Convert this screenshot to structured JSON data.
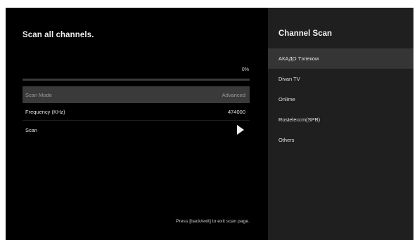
{
  "main": {
    "title": "Scan all channels.",
    "progress": {
      "label": "0%",
      "percent": 0
    },
    "rows": [
      {
        "label": "Scan Mode",
        "value": "Advanced"
      },
      {
        "label": "Frequency (KHz)",
        "value": "474000"
      },
      {
        "label": "Scan",
        "icon": "play-icon"
      }
    ],
    "footer_hint": "Press [back/exit] to exit scan page."
  },
  "panel": {
    "title": "Channel Scan",
    "items": [
      {
        "label": "АКАДО Тэлеком"
      },
      {
        "label": "Divan TV"
      },
      {
        "label": "Onlime"
      },
      {
        "label": "Rosteleccm(SPB)"
      },
      {
        "label": "Others"
      }
    ]
  },
  "colors": {
    "background": "#000000",
    "panel_background": "#1f1f1f",
    "selected_row": "#3a3a3a",
    "text": "#e6e6e6"
  }
}
